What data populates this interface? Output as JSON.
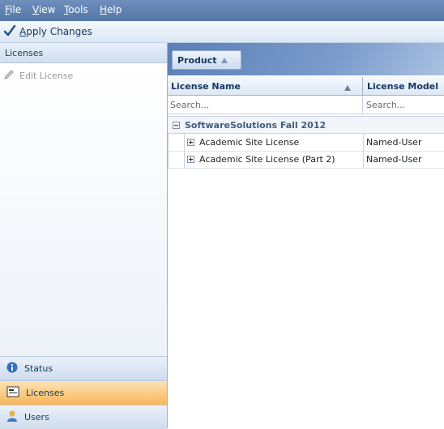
{
  "menu": {
    "items": [
      {
        "label": "File"
      },
      {
        "label": "View"
      },
      {
        "label": "Tools"
      },
      {
        "label": "Help"
      }
    ]
  },
  "toolbar": {
    "apply_label": "Apply Changes"
  },
  "left_panel": {
    "header": "Licenses",
    "edit_label": "Edit License",
    "nav": [
      {
        "label": "Status",
        "icon": "info-icon"
      },
      {
        "label": "Licenses",
        "icon": "license-icon",
        "active": true
      },
      {
        "label": "Users",
        "icon": "user-icon"
      }
    ]
  },
  "grid": {
    "group_chip": "Product",
    "columns": [
      {
        "label": "License Name"
      },
      {
        "label": "License Model"
      }
    ],
    "search_placeholder": "Search...",
    "group_row": "SoftwareSolutions Fall 2012",
    "rows": [
      {
        "name": "Academic Site License",
        "model": "Named-User"
      },
      {
        "name": "Academic Site License (Part 2)",
        "model": "Named-User"
      }
    ]
  },
  "colors": {
    "menubar": "#5f80b1",
    "active_nav": "#f8b65a",
    "header_text": "#15375f"
  }
}
